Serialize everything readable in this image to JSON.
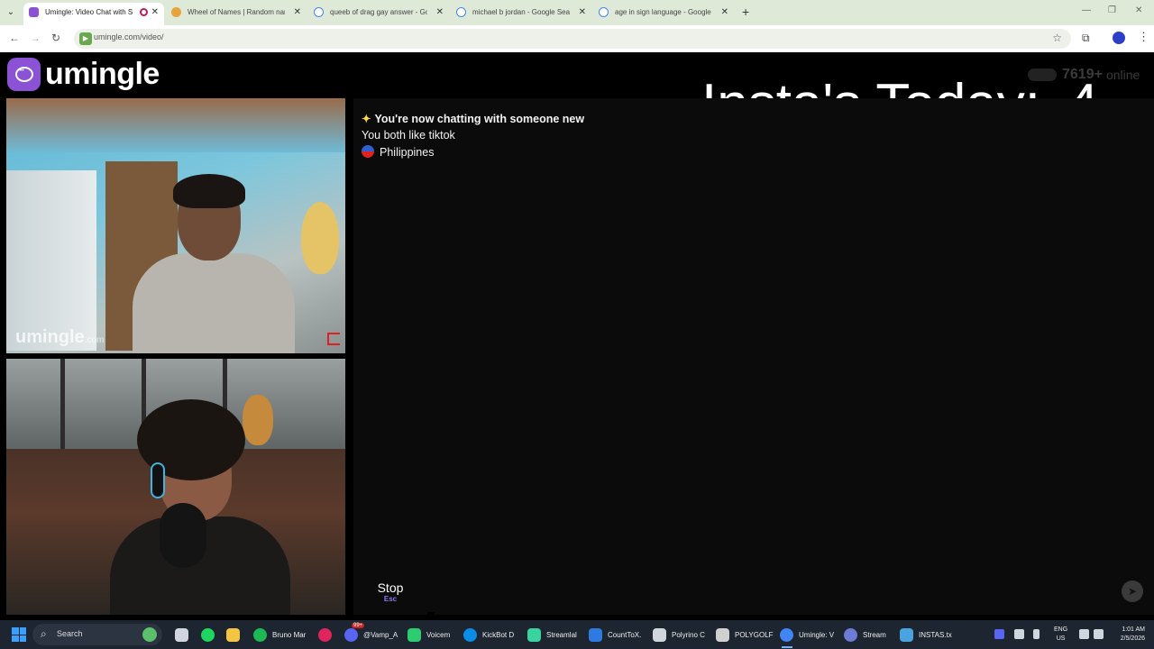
{
  "browser": {
    "tabs": [
      {
        "label": "Umingle: Video Chat with S",
        "active": true,
        "favicon_color": "#8b52d6",
        "recording": true
      },
      {
        "label": "Wheel of Names | Random nam",
        "active": false,
        "favicon_color": "#e8a33d"
      },
      {
        "label": "queeb of drag gay answer - Go",
        "active": false,
        "favicon_color": "#4285f4"
      },
      {
        "label": "michael b jordan - Google Sear",
        "active": false,
        "favicon_color": "#4285f4"
      },
      {
        "label": "age in sign language - Google",
        "active": false,
        "favicon_color": "#4285f4"
      }
    ],
    "new_tab_icon": "plus-icon",
    "url": "umingle.com/video/"
  },
  "site": {
    "logo_text": "umingle",
    "online_count": "7619+",
    "online_label": "online",
    "overlay_title": "Insta's Today:",
    "overlay_count": "4"
  },
  "video": {
    "watermark": "umingle",
    "watermark_suffix": ".com"
  },
  "chat": {
    "messages": [
      {
        "text": "You're now chatting with someone new",
        "icon": "sparkle-icon",
        "bold": true
      },
      {
        "text": "You both like tiktok",
        "bold": false
      },
      {
        "text": "Philippines",
        "icon": "philippines-flag-icon",
        "bold": false
      }
    ]
  },
  "controls": {
    "stop_label": "Stop",
    "stop_key": "Esc",
    "send_icon": "send-icon"
  },
  "taskbar": {
    "search_label": "Search",
    "apps": [
      {
        "label": "",
        "color": "#cfd6dd"
      },
      {
        "label": "",
        "color": "#1ed760"
      },
      {
        "label": "",
        "color": "#f4c542"
      },
      {
        "label": "Bruno Mar",
        "color": "#1db954"
      },
      {
        "label": "",
        "color": "#e0245e"
      },
      {
        "label": "@Vamp_A",
        "color": "#5865f2",
        "badge": "99+"
      },
      {
        "label": "Voicem",
        "color": "#2ecc71"
      },
      {
        "label": "KickBot D",
        "color": "#0c8ce9"
      },
      {
        "label": "Streamlal",
        "color": "#3ad29f"
      },
      {
        "label": "CountToX.",
        "color": "#2d7be0"
      },
      {
        "label": "Polyrino C",
        "color": "#cfd6dd"
      },
      {
        "label": "POLYGOLF",
        "color": "#d0d0d0"
      },
      {
        "label": "Umingle: V",
        "color": "#4285f4",
        "active": true
      },
      {
        "label": "Stream",
        "color": "#6b7bd6"
      },
      {
        "label": "INSTAS.tx",
        "color": "#4aa3df"
      }
    ],
    "lang_top": "ENG",
    "lang_bottom": "US",
    "time": "1:01 AM",
    "date": "2/5/2026"
  }
}
